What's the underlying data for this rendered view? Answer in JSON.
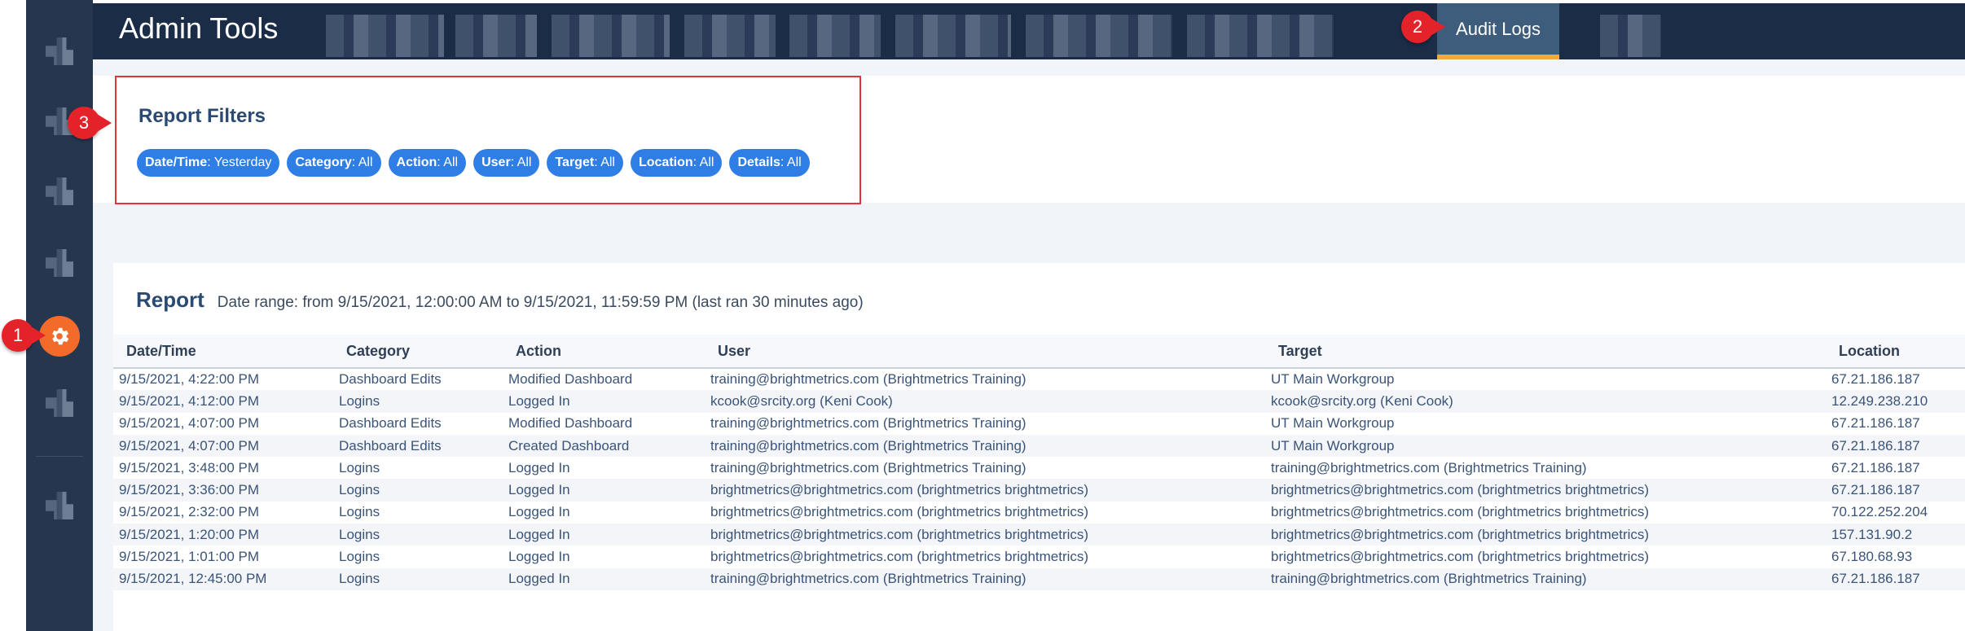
{
  "app": {
    "title": "Admin Tools"
  },
  "nav": {
    "active_tab": "Audit Logs"
  },
  "callouts": [
    "1",
    "2",
    "3"
  ],
  "filters": {
    "title": "Report Filters",
    "chips": [
      {
        "key": "Date/Time",
        "value": ": Yesterday"
      },
      {
        "key": "Category",
        "value": ": All"
      },
      {
        "key": "Action",
        "value": ": All"
      },
      {
        "key": "User",
        "value": ": All"
      },
      {
        "key": "Target",
        "value": ": All"
      },
      {
        "key": "Location",
        "value": ": All"
      },
      {
        "key": "Details",
        "value": ": All"
      }
    ]
  },
  "report": {
    "title": "Report",
    "range": "Date range: from 9/15/2021, 12:00:00 AM to 9/15/2021, 11:59:59 PM (last ran 30 minutes ago)",
    "columns": [
      "Date/Time",
      "Category",
      "Action",
      "User",
      "Target",
      "Location"
    ],
    "rows": [
      [
        "9/15/2021, 4:22:00 PM",
        "Dashboard Edits",
        "Modified Dashboard",
        "training@brightmetrics.com (Brightmetrics Training)",
        "UT Main Workgroup",
        "67.21.186.187"
      ],
      [
        "9/15/2021, 4:12:00 PM",
        "Logins",
        "Logged In",
        "kcook@srcity.org (Keni Cook)",
        "kcook@srcity.org (Keni Cook)",
        "12.249.238.210"
      ],
      [
        "9/15/2021, 4:07:00 PM",
        "Dashboard Edits",
        "Modified Dashboard",
        "training@brightmetrics.com (Brightmetrics Training)",
        "UT Main Workgroup",
        "67.21.186.187"
      ],
      [
        "9/15/2021, 4:07:00 PM",
        "Dashboard Edits",
        "Created Dashboard",
        "training@brightmetrics.com (Brightmetrics Training)",
        "UT Main Workgroup",
        "67.21.186.187"
      ],
      [
        "9/15/2021, 3:48:00 PM",
        "Logins",
        "Logged In",
        "training@brightmetrics.com (Brightmetrics Training)",
        "training@brightmetrics.com (Brightmetrics Training)",
        "67.21.186.187"
      ],
      [
        "9/15/2021, 3:36:00 PM",
        "Logins",
        "Logged In",
        "brightmetrics@brightmetrics.com (brightmetrics brightmetrics)",
        "brightmetrics@brightmetrics.com (brightmetrics brightmetrics)",
        "67.21.186.187"
      ],
      [
        "9/15/2021, 2:32:00 PM",
        "Logins",
        "Logged In",
        "brightmetrics@brightmetrics.com (brightmetrics brightmetrics)",
        "brightmetrics@brightmetrics.com (brightmetrics brightmetrics)",
        "70.122.252.204"
      ],
      [
        "9/15/2021, 1:20:00 PM",
        "Logins",
        "Logged In",
        "brightmetrics@brightmetrics.com (brightmetrics brightmetrics)",
        "brightmetrics@brightmetrics.com (brightmetrics brightmetrics)",
        "157.131.90.2"
      ],
      [
        "9/15/2021, 1:01:00 PM",
        "Logins",
        "Logged In",
        "brightmetrics@brightmetrics.com (brightmetrics brightmetrics)",
        "brightmetrics@brightmetrics.com (brightmetrics brightmetrics)",
        "67.180.68.93"
      ],
      [
        "9/15/2021, 12:45:00 PM",
        "Logins",
        "Logged In",
        "training@brightmetrics.com (Brightmetrics Training)",
        "training@brightmetrics.com (Brightmetrics Training)",
        "67.21.186.187"
      ]
    ]
  },
  "colors": {
    "topbar": "#1b2c47",
    "sidebar": "#27364f",
    "active_tab": "#3e5c7c",
    "active_tab_underline": "#f2a93b",
    "chip": "#2f7ee6",
    "gear": "#f26b2b",
    "callout": "#e4222a"
  }
}
